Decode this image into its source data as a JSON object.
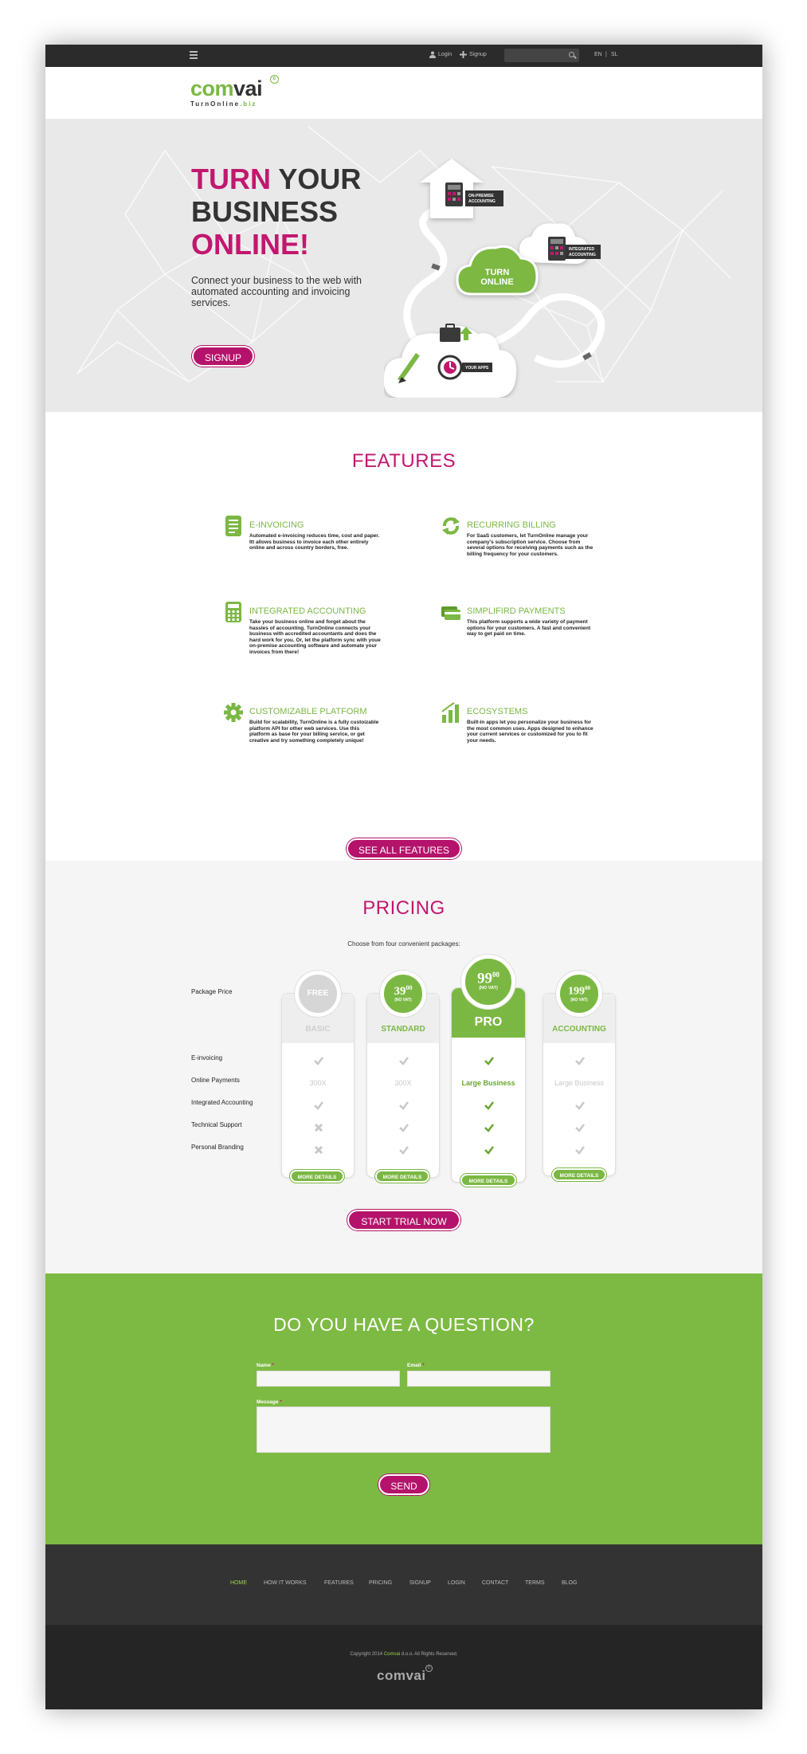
{
  "topbar": {
    "login_label": "Login",
    "signup_label": "Signup",
    "lang_en": "EN",
    "lang_sep": "|",
    "lang_sl": "SL"
  },
  "logo": {
    "word_a": "com",
    "word_b": "vai",
    "tagline_a": "TurnOnline",
    "tagline_b": ".biz",
    "copyright_mark": "c"
  },
  "hero": {
    "title_word1": "TURN",
    "title_word2": " YOUR",
    "title_line2": "BUSINESS",
    "title_line3": "ONLINE!",
    "subtitle": "Connect your business to the web with automated accounting and invoicing services.",
    "signup_button": "SIGNUP",
    "art_labels": {
      "on_premise": [
        "ON-PREMISE",
        "ACCOUNTING"
      ],
      "integrated": [
        "INTEGRATED",
        "ACCOUNTING"
      ],
      "turn_online": [
        "TURN",
        "ONLINE"
      ],
      "your_apps": "YOUR APPS"
    }
  },
  "features": {
    "title": "FEATURES",
    "items": [
      {
        "icon": "document-icon",
        "title": "E-INVOICING",
        "desc": "Automated e-invoicing reduces time, cost and paper. Itt allows business to invoice each other entirely online and across country borders, free."
      },
      {
        "icon": "refresh-icon",
        "title": "RECURRING BILLING",
        "desc": "For SaaS customers, let TurnOnline manage your company's subscription service. Choose from several options for receiving payments such as the billing frequency for your customers."
      },
      {
        "icon": "calculator-icon",
        "title": "INTEGRATED ACCOUNTING",
        "desc": "Take your business online and forget about the hassles of accounting. TurnOnline connects your business with accredited accountants and does the hard work for you. Or, let the platform sync with youe on-premise accounting software and automate your invoices from there!"
      },
      {
        "icon": "credit-card-icon",
        "title": "SIMPLIFIRD PAYMENTS",
        "desc": "This platform supports a wide variety of payment options for your customers. A fast and convenient way to get paid on time."
      },
      {
        "icon": "gear-icon",
        "title": "CUSTOMIZABLE PLATFORM",
        "desc": "Build for scalability, TurnOnline is a fully custoizable platform API for other web services. Use this platform as base for your billing service, or get creative and try something completely unique!"
      },
      {
        "icon": "bar-chart-icon",
        "title": "ECOSYSTEMS",
        "desc": "Built-in apps let you personalize your business for the most common uses. Apps designed to enhance your current services or customized for you to fit your needs."
      }
    ],
    "see_all_button": "SEE ALL FEATURES"
  },
  "pricing": {
    "title": "PRICING",
    "intro": "Choose from four convenient packages:",
    "row_labels": [
      "Package Price",
      "E-invoicing",
      "Online Payments",
      "Integrated Accounting",
      "Technical Support",
      "Personal Branding"
    ],
    "plans": [
      {
        "name": "BASIC",
        "price": "FREE",
        "price_int": "",
        "price_dec": "",
        "vat": "",
        "online_payments": "300X",
        "more": "MORE DETAILS"
      },
      {
        "name": "STANDARD",
        "price": "",
        "price_int": "39",
        "price_dec": "00",
        "vat": "(NO VAT)",
        "online_payments": "300X",
        "more": "MORE DETAILS"
      },
      {
        "name": "PRO",
        "price": "",
        "price_int": "99",
        "price_dec": "00",
        "vat": "(NO VAT)",
        "online_payments": "Large Business",
        "more": "MORE DETAILS"
      },
      {
        "name": "ACCOUNTING",
        "price": "",
        "price_int": "199",
        "price_dec": "00",
        "vat": "(NO VAT)",
        "online_payments": "Large Business",
        "more": "MORE DETAILS"
      }
    ],
    "trial_button": "START TRIAL NOW"
  },
  "contact": {
    "title": "DO YOU HAVE A QUESTION?",
    "name_label": "Name",
    "email_label": "Email",
    "message_label": "Message",
    "required_mark": "*",
    "send_button": "SEND"
  },
  "footer": {
    "nav": [
      "HOME",
      "HOW IT WORKS",
      "FEATURES",
      "PRICING",
      "SIGNUP",
      "LOGIN",
      "CONTACT",
      "TERMS",
      "BLOG"
    ],
    "copyright_a": "Copyright 2014 ",
    "copyright_brand": "Comvai",
    "copyright_b": " d.o.o. All Rights Reserved.",
    "logo_text": "comvai",
    "logo_mark": "c"
  },
  "colors": {
    "brand_green": "#7bb843",
    "brand_magenta": "#b5136b",
    "dark_bar": "#2b2b2b"
  }
}
